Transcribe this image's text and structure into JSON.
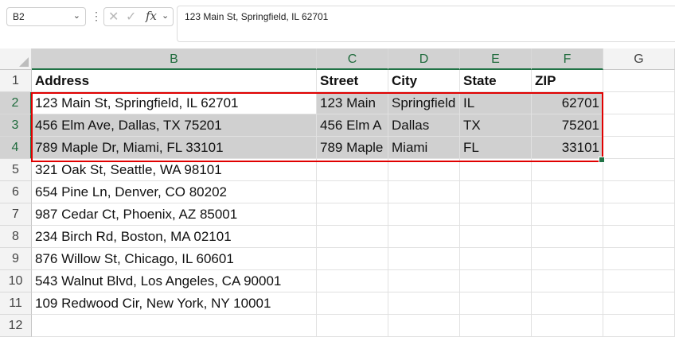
{
  "name_box": {
    "value": "B2",
    "arrow": "⌄"
  },
  "formula_bar": {
    "menu_glyph": "⋮",
    "cancel_glyph": "✕",
    "enter_glyph": "✓",
    "fx_label": "fx",
    "arrow": "⌄",
    "content": "123 Main St, Springfield, IL 62701"
  },
  "columns": [
    "B",
    "C",
    "D",
    "E",
    "F",
    "G"
  ],
  "rows": [
    "1",
    "2",
    "3",
    "4",
    "5",
    "6",
    "7",
    "8",
    "9",
    "10",
    "11",
    "12"
  ],
  "sheet": {
    "headers": {
      "B": "Address",
      "C": "Street",
      "D": "City",
      "E": "State",
      "F": "ZIP"
    },
    "addresses": [
      "123 Main St, Springfield, IL 62701",
      "456 Elm Ave, Dallas, TX 75201",
      "789 Maple Dr, Miami, FL 33101",
      "321 Oak St, Seattle, WA 98101",
      "654 Pine Ln, Denver, CO 80202",
      "987 Cedar Ct, Phoenix, AZ 85001",
      "234 Birch Rd, Boston, MA 02101",
      "876 Willow St, Chicago, IL 60601",
      "543 Walnut Blvd, Los Angeles, CA 90001",
      "109 Redwood Cir, New York, NY 10001"
    ],
    "split": [
      {
        "street": "123 Main",
        "city": "Springfield",
        "state": "IL",
        "zip": "62701"
      },
      {
        "street": "456 Elm A",
        "city": "Dallas",
        "state": "TX",
        "zip": "75201"
      },
      {
        "street": "789 Maple",
        "city": "Miami",
        "state": "FL",
        "zip": "33101"
      }
    ]
  },
  "colors": {
    "selection_outline": "#e00000",
    "selected_fill": "#d0d0d0",
    "header_accent": "#217346"
  }
}
